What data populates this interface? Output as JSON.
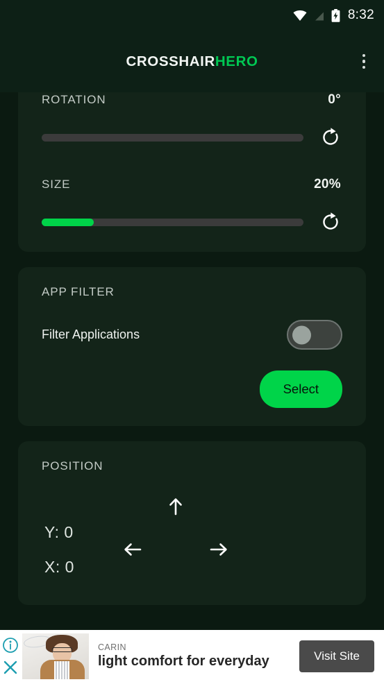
{
  "status_bar": {
    "time": "8:32",
    "icons": [
      "wifi-icon",
      "signal-off-icon",
      "battery-charging-icon"
    ]
  },
  "app_bar": {
    "title_primary": "CROSSHAIR",
    "title_accent": "HERO",
    "overflow_label": "more-options",
    "accent_color": "#00c853",
    "background": "#0d2016"
  },
  "cards": {
    "controls": {
      "rotation": {
        "label": "ROTATION",
        "value": "0°",
        "percent": 0,
        "reset_label": "reset-rotation"
      },
      "size": {
        "label": "SIZE",
        "value": "20%",
        "percent": 20,
        "reset_label": "reset-size"
      }
    },
    "app_filter": {
      "title": "APP FILTER",
      "toggle_label": "Filter Applications",
      "toggle_state": "off",
      "select_button": "Select"
    },
    "position": {
      "title": "POSITION",
      "y_value": "Y: 0",
      "x_value": "X: 0",
      "arrows": [
        "arrow-up",
        "arrow-left",
        "arrow-right"
      ]
    }
  },
  "ad": {
    "brand": "CARIN",
    "headline": "light comfort for everyday",
    "cta": "Visit Site",
    "info_label": "ad-info",
    "close_label": "ad-close",
    "control_color": "#1d9eb0"
  },
  "theme": {
    "page_background": "#0b1a11",
    "card_background": "#132419",
    "accent_green": "#00d449",
    "track_gray": "#3b3b3b"
  }
}
